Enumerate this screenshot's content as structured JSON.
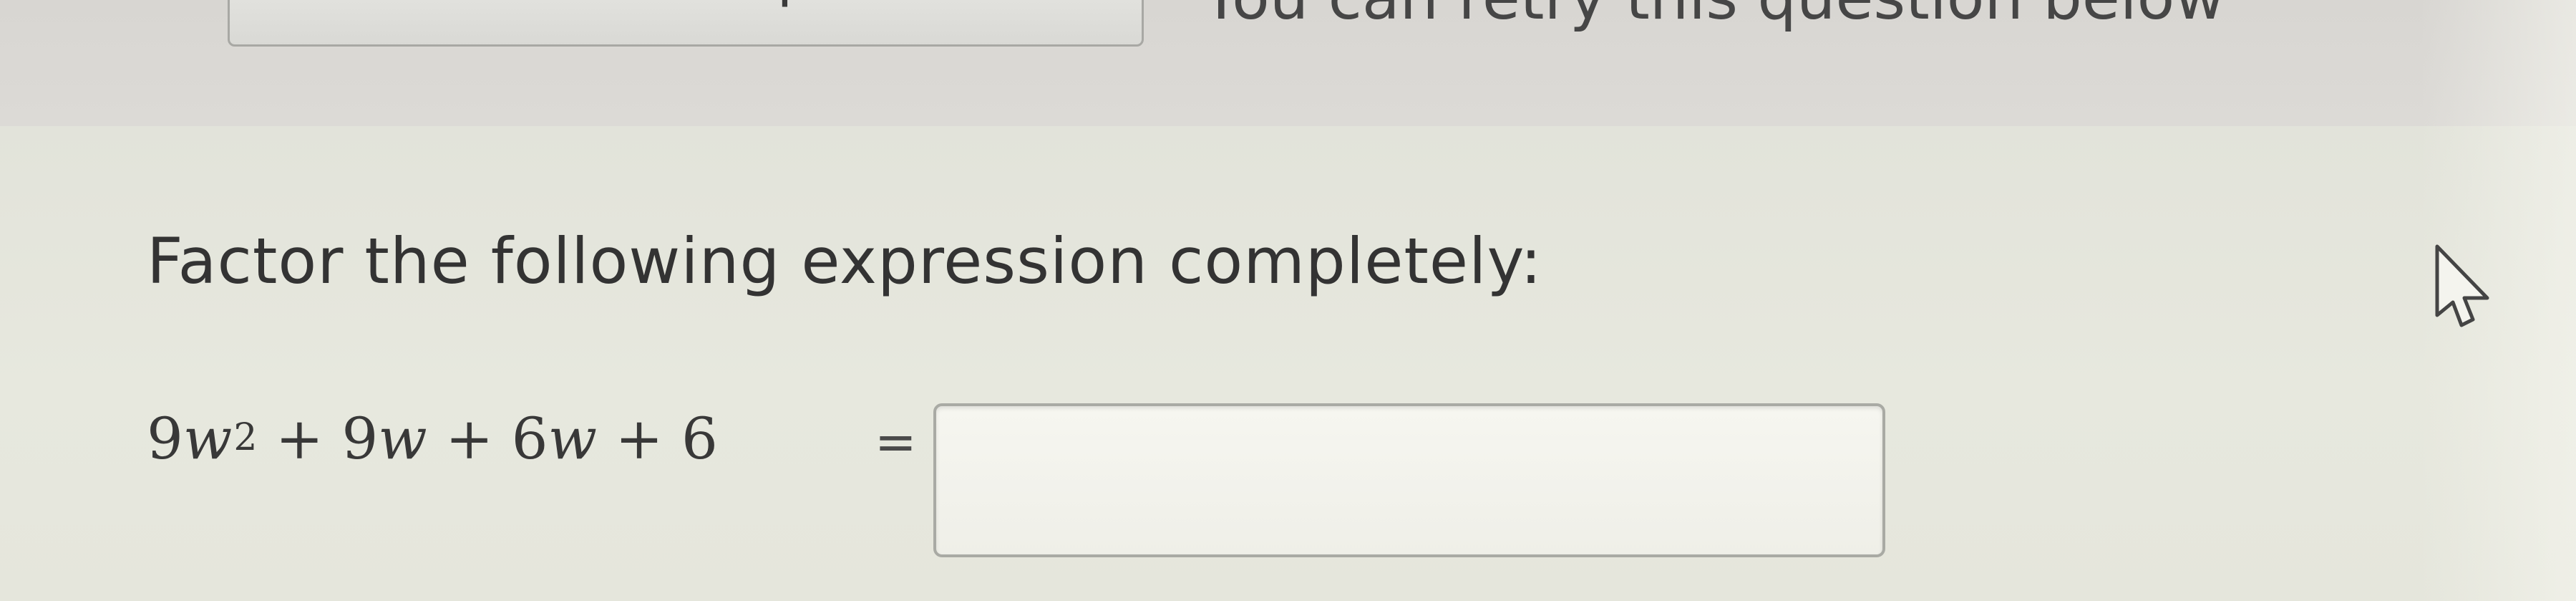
{
  "header": {
    "similar_button_label": "See a similar question",
    "retry_text": "You can retry this question below"
  },
  "question": {
    "prompt": "Factor the following expression completely:",
    "expression_parts": {
      "term1_coef": "9",
      "term1_var": "w",
      "term1_exp": "2",
      "op1": " + ",
      "term2_coef": "9",
      "term2_var": "w",
      "op2": " + ",
      "term3_coef": "6",
      "term3_var": "w",
      "op3": " + ",
      "term4": "6"
    },
    "equals": "=",
    "answer_value": ""
  },
  "icons": {
    "cursor": "mouse-pointer-icon"
  }
}
